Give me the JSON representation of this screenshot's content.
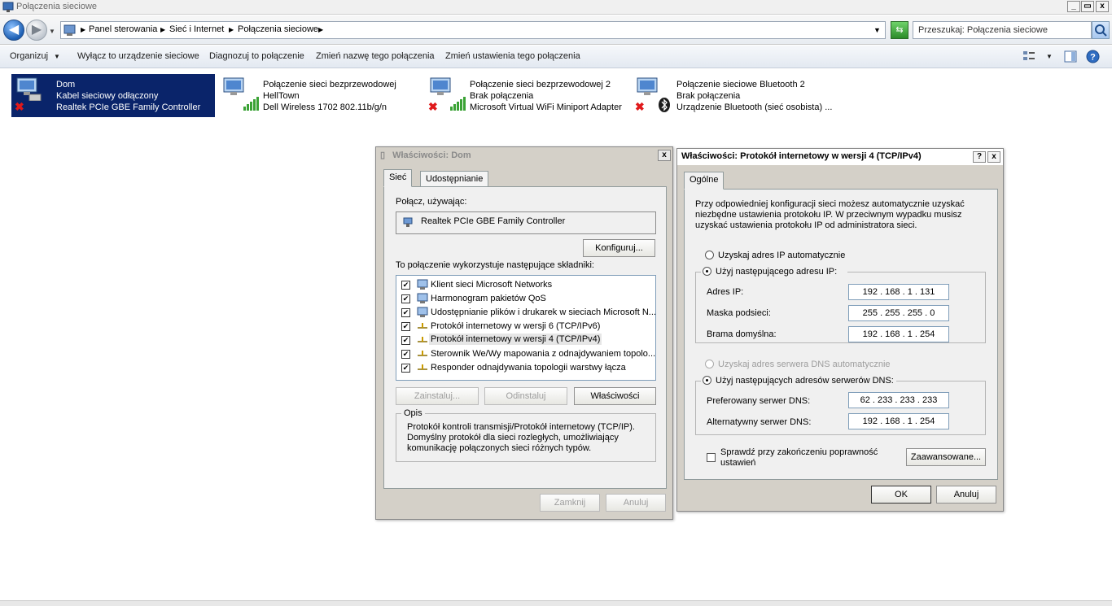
{
  "window": {
    "title": "Połączenia sieciowe",
    "min": "_",
    "max": "▭",
    "close": "x"
  },
  "address": {
    "crumbs": [
      "Panel sterowania",
      "Sieć i Internet",
      "Połączenia sieciowe"
    ],
    "search_placeholder": "Przeszukaj: Połączenia sieciowe"
  },
  "toolbar": {
    "organize": "Organizuj",
    "disable": "Wyłącz to urządzenie sieciowe",
    "diagnose": "Diagnozuj to połączenie",
    "rename": "Zmień nazwę tego połączenia",
    "settings": "Zmień ustawienia tego połączenia"
  },
  "connections": [
    {
      "name": "Dom",
      "status": "Kabel sieciowy odłączony",
      "device": "Realtek PCIe GBE Family Controller",
      "selected": true
    },
    {
      "name": "Połączenie sieci bezprzewodowej",
      "status": "HellTown",
      "device": "Dell Wireless 1702 802.11b/g/n"
    },
    {
      "name": "Połączenie sieci bezprzewodowej 2",
      "status": "Brak połączenia",
      "device": "Microsoft Virtual WiFi Miniport Adapter"
    },
    {
      "name": "Połączenie sieciowe Bluetooth 2",
      "status": "Brak połączenia",
      "device": "Urządzenie Bluetooth (sieć osobista) ..."
    }
  ],
  "props_dialog": {
    "title": "Właściwości: Dom",
    "close": "x",
    "tabs": [
      "Sieć",
      "Udostępnianie"
    ],
    "connect_using_label": "Połącz, używając:",
    "adapter": "Realtek PCIe GBE Family Controller",
    "configure": "Konfiguruj...",
    "components_label": "To połączenie wykorzystuje następujące składniki:",
    "components": [
      "Klient sieci Microsoft Networks",
      "Harmonogram pakietów QoS",
      "Udostępnianie plików i drukarek w sieciach Microsoft N...",
      "Protokół internetowy w wersji 6 (TCP/IPv6)",
      "Protokół internetowy w wersji 4 (TCP/IPv4)",
      "Sterownik We/Wy mapowania z odnajdywaniem topolo...",
      "Responder odnajdywania topologii warstwy łącza"
    ],
    "install": "Zainstaluj...",
    "uninstall": "Odinstaluj",
    "properties": "Właściwości",
    "desc_label": "Opis",
    "description": "Protokół kontroli transmisji/Protokół internetowy (TCP/IP). Domyślny protokół dla sieci rozległych, umożliwiający komunikację połączonych sieci różnych typów.",
    "close_btn": "Zamknij",
    "cancel_btn": "Anuluj"
  },
  "ipv4_dialog": {
    "title": "Właściwości: Protokół internetowy w wersji 4 (TCP/IPv4)",
    "help": "?",
    "close": "x",
    "tab": "Ogólne",
    "intro": "Przy odpowiedniej konfiguracji sieci możesz automatycznie uzyskać niezbędne ustawienia protokołu IP. W przeciwnym wypadku musisz uzyskać ustawienia protokołu IP od administratora sieci.",
    "auto_ip": "Uzyskaj adres IP automatycznie",
    "manual_ip": "Użyj następującego adresu IP:",
    "ip_label": "Adres IP:",
    "ip": "192 . 168 .  1  . 131",
    "mask_label": "Maska podsieci:",
    "mask": "255 . 255 . 255 .  0",
    "gw_label": "Brama domyślna:",
    "gw": "192 . 168 .  1  . 254",
    "auto_dns": "Uzyskaj adres serwera DNS automatycznie",
    "manual_dns": "Użyj następujących adresów serwerów DNS:",
    "dns1_label": "Preferowany serwer DNS:",
    "dns1": "62 . 233 . 233 . 233",
    "dns2_label": "Alternatywny serwer DNS:",
    "dns2": "192 . 168 .  1  . 254",
    "validate": "Sprawdź przy zakończeniu poprawność ustawień",
    "advanced": "Zaawansowane...",
    "ok": "OK",
    "cancel": "Anuluj"
  }
}
